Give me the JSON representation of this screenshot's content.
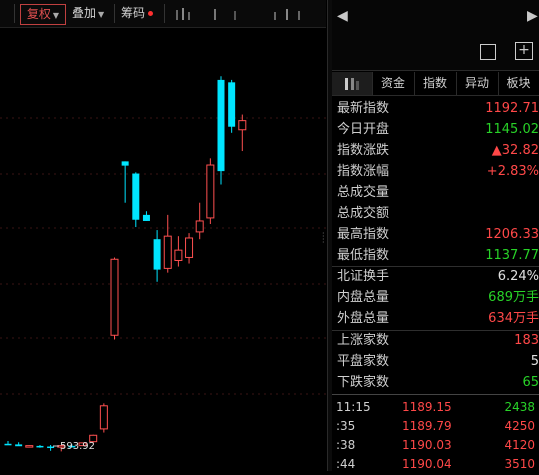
{
  "toolbar": {
    "fq_label": "复权",
    "overlay_label": "叠加",
    "chip_label": "筹码"
  },
  "chart": {
    "low_marker": "593.92",
    "colors": {
      "up": "#ff5050",
      "down": "#00e5ff"
    }
  },
  "chart_data": {
    "type": "candlestick",
    "candles": [
      {
        "o": 593.5,
        "h": 598.0,
        "l": 591.5,
        "c": 591.0
      },
      {
        "o": 592.5,
        "h": 596.0,
        "l": 590.0,
        "c": 589.5
      },
      {
        "o": 589.5,
        "h": 591.0,
        "l": 587.5,
        "c": 590.5
      },
      {
        "o": 590.0,
        "h": 591.5,
        "l": 587.0,
        "c": 589.0
      },
      {
        "o": 589.0,
        "h": 591.5,
        "l": 582.0,
        "c": 588.0
      },
      {
        "o": 589.0,
        "h": 590.0,
        "l": 581.0,
        "c": 590.5
      },
      {
        "o": 590.0,
        "h": 592.5,
        "l": 588.5,
        "c": 589.5
      },
      {
        "o": 590.5,
        "h": 595.5,
        "l": 590.0,
        "c": 595.0
      },
      {
        "o": 597.0,
        "h": 608.5,
        "l": 595.0,
        "c": 607.5
      },
      {
        "o": 618.0,
        "h": 660.0,
        "l": 612.0,
        "c": 656.0
      },
      {
        "o": 772.0,
        "h": 900.0,
        "l": 765.0,
        "c": 897.0
      },
      {
        "o": 1058.0,
        "h": 1058.0,
        "l": 990.0,
        "c": 1051.0
      },
      {
        "o": 1038.0,
        "h": 1040.0,
        "l": 950.0,
        "c": 962.0
      },
      {
        "o": 970.0,
        "h": 976.0,
        "l": 960.0,
        "c": 960.0
      },
      {
        "o": 930.0,
        "h": 945.0,
        "l": 860.0,
        "c": 880.0
      },
      {
        "o": 882.0,
        "h": 970.0,
        "l": 875.0,
        "c": 935.0
      },
      {
        "o": 895.0,
        "h": 935.0,
        "l": 885.0,
        "c": 912.0
      },
      {
        "o": 900.0,
        "h": 940.0,
        "l": 890.0,
        "c": 932.0
      },
      {
        "o": 942.0,
        "h": 990.0,
        "l": 930.0,
        "c": 960.0
      },
      {
        "o": 965.0,
        "h": 1063.0,
        "l": 955.0,
        "c": 1052.0
      },
      {
        "o": 1192.0,
        "h": 1198.0,
        "l": 1020.0,
        "c": 1042.0
      },
      {
        "o": 1188.0,
        "h": 1192.0,
        "l": 1105.0,
        "c": 1115.0
      },
      {
        "o": 1110.0,
        "h": 1135.0,
        "l": 1075.0,
        "c": 1125.0
      }
    ]
  },
  "panel": {
    "tabs": [
      "资金",
      "指数",
      "异动",
      "板块"
    ],
    "rows": [
      {
        "label": "最新指数",
        "value": "1192.71",
        "color": "red"
      },
      {
        "label": "今日开盘",
        "value": "1145.02",
        "color": "green"
      },
      {
        "label": "指数涨跌",
        "value": "▲32.82",
        "color": "red"
      },
      {
        "label": "指数涨幅",
        "value": "+2.83%",
        "color": "red"
      },
      {
        "label": "总成交量",
        "value": "",
        "color": "gray"
      },
      {
        "label": "总成交额",
        "value": "",
        "color": "gray"
      },
      {
        "label": "最高指数",
        "value": "1206.33",
        "color": "red"
      },
      {
        "label": "最低指数",
        "value": "1137.77",
        "color": "green"
      }
    ],
    "rows2": [
      {
        "label": "北证换手",
        "value": "6.24%",
        "color": "white"
      },
      {
        "label": "内盘总量",
        "value": "689万手",
        "color": "green"
      },
      {
        "label": "外盘总量",
        "value": "634万手",
        "color": "red"
      }
    ],
    "rows3": [
      {
        "label": "上涨家数",
        "value": "183",
        "color": "red"
      },
      {
        "label": "平盘家数",
        "value": "5",
        "color": "white"
      },
      {
        "label": "下跌家数",
        "value": "65",
        "color": "green"
      }
    ],
    "ticks": [
      {
        "time": "11:15",
        "price": "1189.15",
        "vol": "2438",
        "color": "green"
      },
      {
        "time": ":35",
        "price": "1189.79",
        "vol": "4250",
        "color": "red"
      },
      {
        "time": ":38",
        "price": "1190.03",
        "vol": "4120",
        "color": "red"
      },
      {
        "time": ":44",
        "price": "1190.04",
        "vol": "3510",
        "color": "red"
      }
    ]
  }
}
